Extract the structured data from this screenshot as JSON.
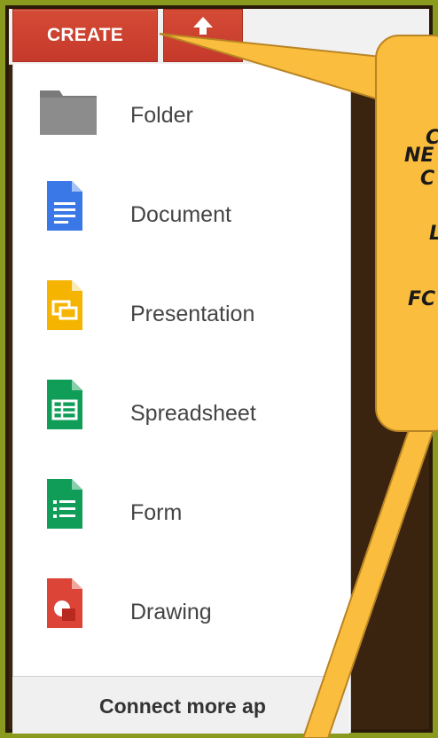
{
  "toolbar": {
    "create_label": "CREATE",
    "upload_icon": "upload-arrow-icon"
  },
  "menu": {
    "items": [
      {
        "label": "Folder",
        "icon": "folder-icon",
        "color": "#777777"
      },
      {
        "label": "Document",
        "icon": "document-icon",
        "color": "#3b78e7"
      },
      {
        "label": "Presentation",
        "icon": "presentation-icon",
        "color": "#f4b400"
      },
      {
        "label": "Spreadsheet",
        "icon": "spreadsheet-icon",
        "color": "#0f9d58"
      },
      {
        "label": "Form",
        "icon": "form-icon",
        "color": "#0f9d58"
      },
      {
        "label": "Drawing",
        "icon": "drawing-icon",
        "color": "#db4437"
      }
    ],
    "connect_label": "Connect more ap"
  },
  "callout": {
    "lines": [
      "C",
      "NE",
      "C",
      "L",
      "FC"
    ],
    "color": "#fbbd3d"
  },
  "colors": {
    "frame": "#8a9a1e",
    "create_button": "#cc4331"
  }
}
